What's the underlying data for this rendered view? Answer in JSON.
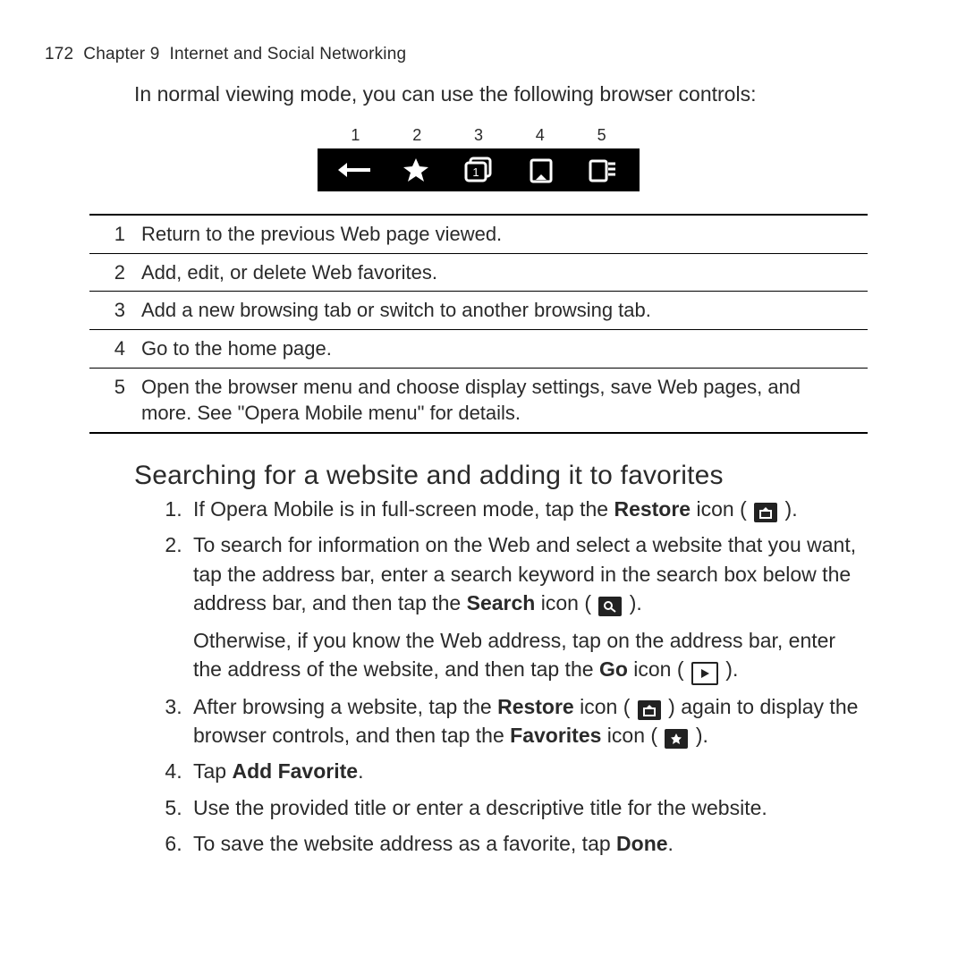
{
  "header": {
    "page_number": "172",
    "chapter_label": "Chapter 9",
    "chapter_title": "Internet and Social Networking"
  },
  "intro": "In normal viewing mode, you can use the following browser controls:",
  "toolbar_labels": [
    "1",
    "2",
    "3",
    "4",
    "5"
  ],
  "toolbar_icons": [
    "back-arrow-icon",
    "star-icon",
    "tabs-icon",
    "home-icon",
    "menu-icon"
  ],
  "controls": [
    {
      "n": "1",
      "d": "Return to the previous Web page viewed."
    },
    {
      "n": "2",
      "d": "Add, edit, or delete Web favorites."
    },
    {
      "n": "3",
      "d": "Add a new browsing tab or switch to another browsing tab."
    },
    {
      "n": "4",
      "d": "Go to the home page."
    },
    {
      "n": "5",
      "d": "Open the browser menu and choose display settings, save Web pages, and more. See \"Opera Mobile menu\" for details."
    }
  ],
  "section_title": "Searching for a website and adding it to favorites",
  "steps": {
    "s1a": "If Opera Mobile is in full-screen mode, tap the ",
    "s1_restore": "Restore",
    "s1b": " icon ( ",
    "s1c": " ).",
    "s2a": "To search for information on the Web and select a website that you want, tap the address bar, enter a search keyword in the search box below the address bar, and then tap the ",
    "s2_search": "Search",
    "s2b": " icon ( ",
    "s2c": " ).",
    "s2p2a": "Otherwise, if you know the Web address, tap on the address bar, enter the address of the website, and then tap the ",
    "s2_go": "Go",
    "s2p2b": " icon ( ",
    "s2p2c": " ).",
    "s3a": "After browsing a website, tap the ",
    "s3_restore": "Restore",
    "s3b": " icon ( ",
    "s3c": " ) again to display the browser controls, and then tap the ",
    "s3_fav": "Favorites",
    "s3d": " icon ( ",
    "s3e": " ).",
    "s4a": "Tap ",
    "s4_addfav": "Add Favorite",
    "s4b": ".",
    "s5": "Use the provided title or enter a descriptive title for the website.",
    "s6a": "To save the website address as a favorite, tap ",
    "s6_done": "Done",
    "s6b": "."
  }
}
